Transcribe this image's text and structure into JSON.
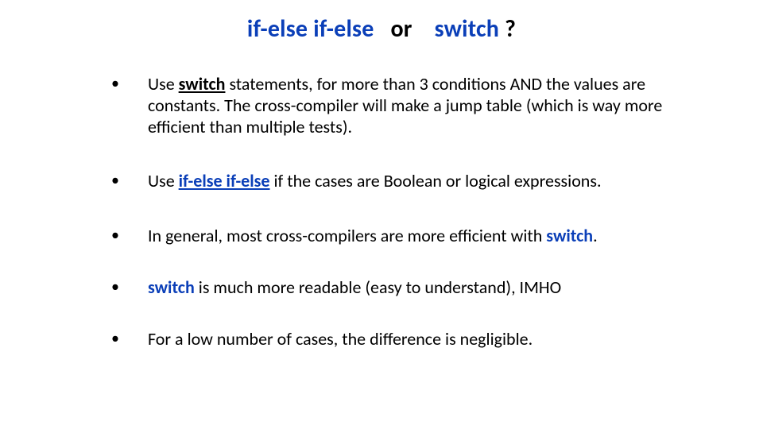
{
  "title": {
    "part1_blue_bold": "if-else if-else",
    "part2_black_bold": "   or    ",
    "part3_blue_bold": "switch",
    "part4_black_bold": " ?"
  },
  "bullets": {
    "b1": {
      "t1": "Use ",
      "kw_bold_u": "switch",
      "t2": " statements, for more than 3 conditions AND the values are constants.  The cross-compiler will make a jump table (which is way more efficient than multiple tests)."
    },
    "b2": {
      "t1": "Use ",
      "kw_blue_bold_u": "if-else if-else",
      "t2": " if the cases are Boolean or logical expressions."
    },
    "b3": {
      "t1": "In general, most cross-compilers are more efficient with ",
      "kw_blue_bold": "switch",
      "t2": "."
    },
    "b4": {
      "lead_space": " ",
      "kw_blue_bold": "switch",
      "t2": "  is much more readable (easy to understand), IMHO"
    },
    "b5": {
      "t1": "For a low number of cases, the difference is negligible."
    }
  }
}
